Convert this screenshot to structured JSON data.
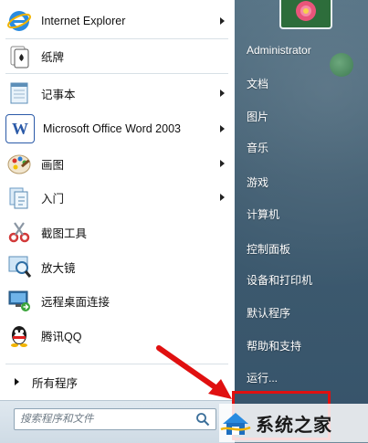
{
  "programs": [
    {
      "label": "Internet Explorer",
      "icon": "internet-explorer-icon",
      "submenu": true
    },
    {
      "label": "纸牌",
      "icon": "solitaire-icon",
      "submenu": false
    },
    {
      "label": "记事本",
      "icon": "notepad-icon",
      "submenu": true
    },
    {
      "label": "Microsoft Office Word 2003",
      "icon": "word-icon",
      "submenu": true
    },
    {
      "label": "画图",
      "icon": "paint-icon",
      "submenu": true
    },
    {
      "label": "入门",
      "icon": "getting-started-icon",
      "submenu": true
    },
    {
      "label": "截图工具",
      "icon": "snipping-tool-icon",
      "submenu": false
    },
    {
      "label": "放大镜",
      "icon": "magnifier-icon",
      "submenu": false
    },
    {
      "label": "远程桌面连接",
      "icon": "remote-desktop-icon",
      "submenu": false
    },
    {
      "label": "腾讯QQ",
      "icon": "qq-icon",
      "submenu": false
    }
  ],
  "all_programs_label": "所有程序",
  "search": {
    "placeholder": "搜索程序和文件"
  },
  "right_items": [
    {
      "label": "Administrator"
    },
    {
      "label": "文档"
    },
    {
      "label": "图片"
    },
    {
      "label": "音乐"
    },
    {
      "label": "游戏"
    },
    {
      "label": "计算机"
    },
    {
      "label": "控制面板"
    },
    {
      "label": "设备和打印机"
    },
    {
      "label": "默认程序"
    },
    {
      "label": "帮助和支持"
    },
    {
      "label": "运行..."
    }
  ],
  "watermark": {
    "text": "系统之家"
  },
  "colors": {
    "highlight": "#e01010",
    "right_pane": "#3f5c70"
  }
}
